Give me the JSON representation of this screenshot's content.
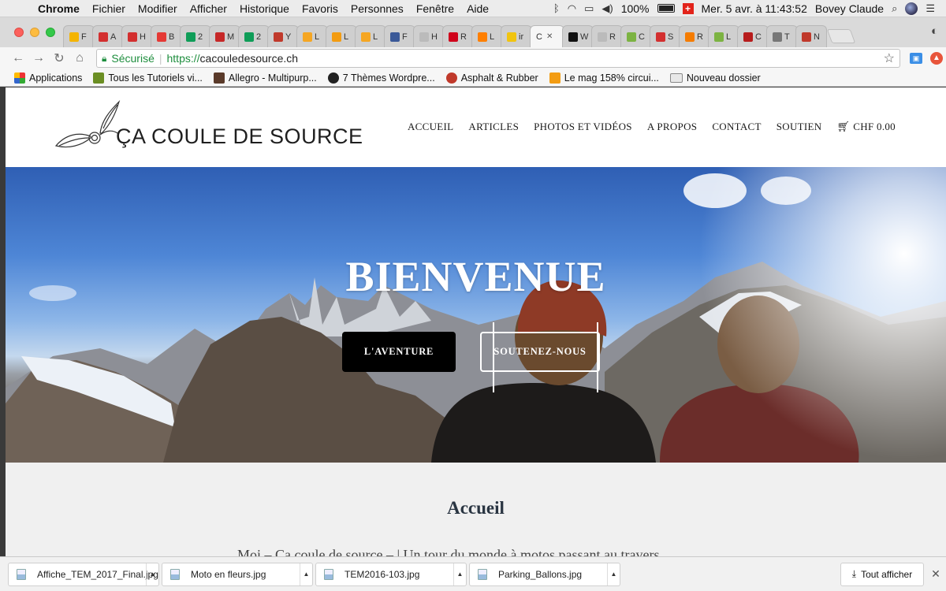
{
  "menubar": {
    "app_name": "Chrome",
    "items": [
      "Fichier",
      "Modifier",
      "Afficher",
      "Historique",
      "Favoris",
      "Personnes",
      "Fenêtre",
      "Aide"
    ],
    "battery": "100%",
    "datetime": "Mer. 5 avr. à  11:43:52",
    "user": "Bovey Claude"
  },
  "tabs": [
    {
      "label": "F",
      "favicon": "analytics-icon",
      "color": "#f4b400"
    },
    {
      "label": "A",
      "favicon": "red-box-icon",
      "color": "#d32f2f"
    },
    {
      "label": "H",
      "favicon": "red-box-icon",
      "color": "#d32f2f"
    },
    {
      "label": "B",
      "favicon": "gmail-icon",
      "color": "#e53935"
    },
    {
      "label": "2",
      "favicon": "sheets-icon",
      "color": "#0f9d58"
    },
    {
      "label": "M",
      "favicon": "motogp-icon",
      "color": "#c62828"
    },
    {
      "label": "2",
      "favicon": "sheets-icon",
      "color": "#0f9d58"
    },
    {
      "label": "Y",
      "favicon": "round-red-icon",
      "color": "#c0392b"
    },
    {
      "label": "L",
      "favicon": "orange-m-icon",
      "color": "#f5a623"
    },
    {
      "label": "L",
      "favicon": "orange-circle-icon",
      "color": "#f39c12"
    },
    {
      "label": "L",
      "favicon": "orange-m-icon",
      "color": "#f5a623"
    },
    {
      "label": "F",
      "favicon": "facebook-icon",
      "color": "#3b5998"
    },
    {
      "label": "H",
      "favicon": "doc-icon",
      "color": "#bbbbbb"
    },
    {
      "label": "R",
      "favicon": "rts-icon",
      "color": "#d0021b"
    },
    {
      "label": "L",
      "favicon": "orange-icon",
      "color": "#ff7f00"
    },
    {
      "label": "ir",
      "favicon": "yellow-o-icon",
      "color": "#f1c40f"
    },
    {
      "label": "C",
      "favicon": "none",
      "color": "#ffffff",
      "active": true
    },
    {
      "label": "W",
      "favicon": "sbk-icon",
      "color": "#111111"
    },
    {
      "label": "R",
      "favicon": "doc-icon",
      "color": "#bbbbbb"
    },
    {
      "label": "C",
      "favicon": "green-box-icon",
      "color": "#7cb342"
    },
    {
      "label": "S",
      "favicon": "suzuki-icon",
      "color": "#d32f2f"
    },
    {
      "label": "R",
      "favicon": "e-icon",
      "color": "#f57c00"
    },
    {
      "label": "L",
      "favicon": "green-box-icon",
      "color": "#7cb342"
    },
    {
      "label": "C",
      "favicon": "mc-icon",
      "color": "#b71c1c"
    },
    {
      "label": "T",
      "favicon": "download-icon",
      "color": "#777777"
    },
    {
      "label": "N",
      "favicon": "round-red-icon",
      "color": "#c0392b"
    }
  ],
  "toolbar": {
    "secure_label": "Sécurisé",
    "url_scheme": "https://",
    "url_host": "cacouledesource.ch"
  },
  "bookmarks": [
    {
      "label": "Applications",
      "icon": "apps-grid-icon"
    },
    {
      "label": "Tous les Tutoriels vi...",
      "icon": "tutorial-icon"
    },
    {
      "label": "Allegro - Multipurp...",
      "icon": "allegro-icon"
    },
    {
      "label": "7 Thèmes Wordpre...",
      "icon": "g-icon"
    },
    {
      "label": "Asphalt & Rubber",
      "icon": "ar-icon"
    },
    {
      "label": "Le mag 158% circui...",
      "icon": "gp-icon"
    },
    {
      "label": "Nouveau dossier",
      "icon": "folder-icon"
    }
  ],
  "site": {
    "logo_text": "ÇA COULE DE SOURCE",
    "nav": [
      "ACCUEIL",
      "ARTICLES",
      "PHOTOS ET VIDÉOS",
      "A PROPOS",
      "CONTACT",
      "SOUTIEN"
    ],
    "cart": "CHF 0.00",
    "hero_title": "BIENVENUE",
    "hero_btn_primary": "L'AVENTURE",
    "hero_btn_secondary": "SOUTENEZ-NOUS",
    "section_title": "Accueil",
    "section_text": "Moi – Ça coule de source – | Un tour du monde à motos passant au travers"
  },
  "downloads": [
    {
      "name": "Affiche_TEM_2017_Final.jpg"
    },
    {
      "name": "Moto en fleurs.jpg"
    },
    {
      "name": "TEM2016-103.jpg"
    },
    {
      "name": "Parking_Ballons.jpg"
    }
  ],
  "show_all_label": "Tout afficher"
}
